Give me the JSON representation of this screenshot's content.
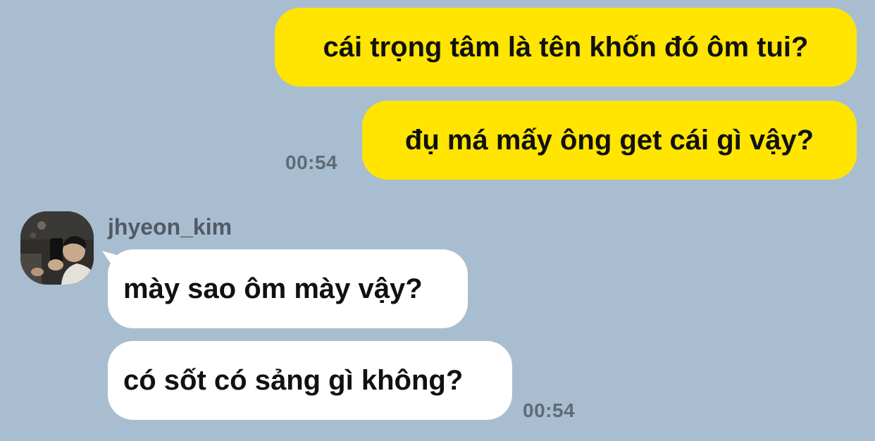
{
  "colors": {
    "background": "#a9bdd0",
    "outgoing_bubble": "#ffe500",
    "incoming_bubble": "#ffffff",
    "message_text": "#111111",
    "timestamp_text": "#5f6b77",
    "sender_name_text": "#4f5a66"
  },
  "outgoing": {
    "messages": [
      {
        "text": "cái trọng tâm là tên khốn đó ôm tui?"
      },
      {
        "text": "đụ má mấy ông get cái gì vậy?"
      }
    ],
    "time": "00:54"
  },
  "incoming": {
    "sender": "jhyeon_kim",
    "avatar_icon": "profile-photo",
    "messages": [
      {
        "text": "mày sao ôm mày vậy?"
      },
      {
        "text": "có sốt có sảng gì không?"
      }
    ],
    "time": "00:54"
  }
}
